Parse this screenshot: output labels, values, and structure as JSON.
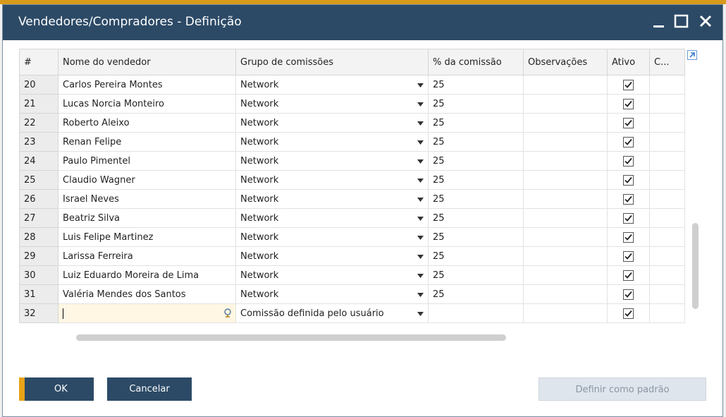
{
  "window": {
    "title": "Vendedores/Compradores - Definição"
  },
  "columns": {
    "num": "#",
    "name": "Nome do vendedor",
    "group": "Grupo de comissões",
    "commission": "% da comissão",
    "notes": "Observações",
    "active": "Ativo",
    "more": "C..."
  },
  "rows": [
    {
      "num": "20",
      "name": "Carlos Pereira Montes",
      "group": "Network",
      "commission": "25",
      "active": true
    },
    {
      "num": "21",
      "name": "Lucas  Norcia Monteiro",
      "group": "Network",
      "commission": "25",
      "active": true
    },
    {
      "num": "22",
      "name": "Roberto Aleixo",
      "group": "Network",
      "commission": "25",
      "active": true
    },
    {
      "num": "23",
      "name": "Renan Felipe",
      "group": "Network",
      "commission": "25",
      "active": true
    },
    {
      "num": "24",
      "name": "Paulo Pimentel",
      "group": "Network",
      "commission": "25",
      "active": true
    },
    {
      "num": "25",
      "name": "Claudio Wagner",
      "group": "Network",
      "commission": "25",
      "active": true
    },
    {
      "num": "26",
      "name": "Israel Neves",
      "group": "Network",
      "commission": "25",
      "active": true
    },
    {
      "num": "27",
      "name": "Beatriz Silva",
      "group": "Network",
      "commission": "25",
      "active": true
    },
    {
      "num": "28",
      "name": "Luis Felipe Martinez",
      "group": "Network",
      "commission": "25",
      "active": true
    },
    {
      "num": "29",
      "name": "Larissa Ferreira",
      "group": "Network",
      "commission": "25",
      "active": true
    },
    {
      "num": "30",
      "name": "Luiz Eduardo Moreira de Lima",
      "group": "Network",
      "commission": "25",
      "active": true
    },
    {
      "num": "31",
      "name": "Valéria Mendes dos Santos",
      "group": "Network",
      "commission": "25",
      "active": true
    }
  ],
  "new_row": {
    "num": "32",
    "name": "",
    "group": "Comissão definida pelo usuário",
    "commission": "",
    "active": true
  },
  "buttons": {
    "ok": "OK",
    "cancel": "Cancelar",
    "set_default": "Definir como padrão"
  },
  "colors": {
    "titlebar": "#2c4a66",
    "accent": "#e8a317",
    "disabled_button": "#dfe5ec"
  },
  "icons": {
    "minimize": "minimize-icon",
    "maximize": "maximize-icon",
    "close": "close-icon",
    "expand": "expand-arrow-icon",
    "lookup": "lookup-icon",
    "dropdown": "dropdown-arrow-icon",
    "checkbox": "checkmark-icon"
  }
}
